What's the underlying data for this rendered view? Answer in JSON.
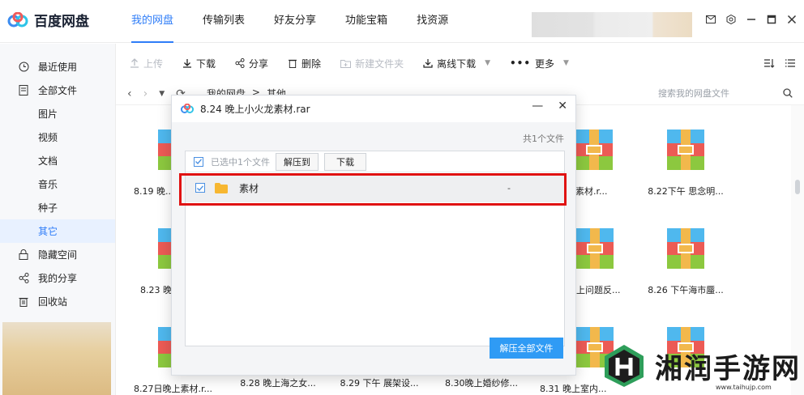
{
  "app": {
    "logo_text": "百度网盘",
    "accent_color": "#2f7df8",
    "nav": [
      {
        "label": "我的网盘",
        "active": true
      },
      {
        "label": "传输列表",
        "active": false
      },
      {
        "label": "好友分享",
        "active": false
      },
      {
        "label": "功能宝箱",
        "active": false
      },
      {
        "label": "找资源",
        "active": false
      }
    ],
    "window_icons": [
      "mail-icon",
      "settings-icon",
      "minimize-icon",
      "maximize-icon",
      "close-icon"
    ]
  },
  "sidebar": {
    "items": [
      {
        "label": "最近使用",
        "icon": "clock-icon"
      },
      {
        "label": "全部文件",
        "icon": "document-icon"
      },
      {
        "label": "图片"
      },
      {
        "label": "视频"
      },
      {
        "label": "文档"
      },
      {
        "label": "音乐"
      },
      {
        "label": "种子"
      },
      {
        "label": "其它",
        "active": true
      },
      {
        "label": "隐藏空间",
        "icon": "lock-icon"
      },
      {
        "label": "我的分享",
        "icon": "share-icon"
      },
      {
        "label": "回收站",
        "icon": "trash-icon"
      }
    ]
  },
  "toolbar": {
    "upload": "上传",
    "download": "下载",
    "share": "分享",
    "delete": "删除",
    "new_folder": "新建文件夹",
    "offline_download": "离线下载",
    "more": "更多"
  },
  "breadcrumb": {
    "root": "我的网盘",
    "separator": ">",
    "current": "其他"
  },
  "search": {
    "placeholder": "搜索我的网盘文件"
  },
  "files": [
    {
      "name": "8.19 晚..."
    },
    {
      "name": "晚上素材.r..."
    },
    {
      "name": "8.22下午 思念明..."
    },
    {
      "name": "8.23 晚..."
    },
    {
      "name": "上问题反..."
    },
    {
      "name": "8.26 下午海市蜃..."
    },
    {
      "name": "8.27日晚上素材.r..."
    },
    {
      "name": "8.28 晚上海之女..."
    },
    {
      "name": "8.29 下午 展架设..."
    },
    {
      "name": "8.30晚上婚纱修..."
    },
    {
      "name": "8.31 晚上室内..."
    }
  ],
  "dialog": {
    "title": "8.24 晚上小火龙素材.rar",
    "file_count": "共1个文件",
    "selected_text": "已选中1个文件",
    "extract_to": "解压到",
    "download": "下载",
    "rows": [
      {
        "name": "素材",
        "size": "-",
        "checked": true
      }
    ],
    "extract_all": "解压全部文件"
  },
  "watermark": {
    "text": "湘润手游网",
    "url": "www.taihujp.com"
  }
}
